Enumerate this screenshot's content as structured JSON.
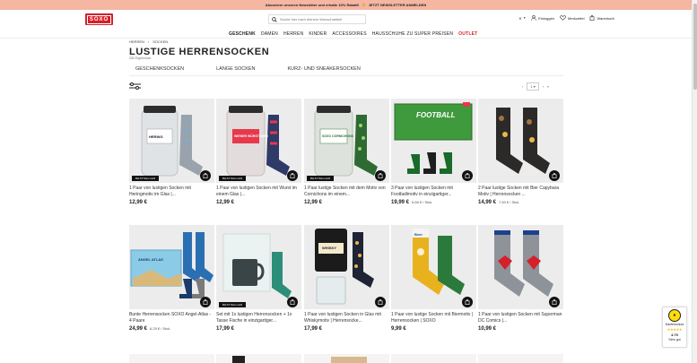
{
  "promo": {
    "text": "Abonniere unseren Newsletter und erhalte 10% Rabatt!",
    "cta": "JETZT NEWSLETTER ANMELDEN"
  },
  "brand": {
    "logo": "SOXO",
    "accent": "#d5202c"
  },
  "search": {
    "placeholder": "Suche hier nach deinem Wunschartikel"
  },
  "header": {
    "currency": "€",
    "login": "Einloggen",
    "wishlist": "Merkzettel",
    "cart": "Warenkorb"
  },
  "nav": {
    "items": [
      "GESCHENK",
      "DAMEN",
      "HERREN",
      "KINDER",
      "ACCESSOIRES",
      "HAUSSCHUHE ZU SUPER PREISEN",
      "OUTLET"
    ]
  },
  "breadcrumb": [
    "HERREN",
    "SOCKEN"
  ],
  "page": {
    "title": "LUSTIGE HERRENSOCKEN",
    "count": "280 Ergebnisse"
  },
  "subcategories": [
    "GESCHENKSOCKEN",
    "LANGE SOCKEN",
    "KURZ- UND SNEAKERSOCKEN"
  ],
  "pager": {
    "current": "1"
  },
  "products": [
    {
      "name": "1 Paar von lustigen Socken mit Heringmotiv im Glas |...",
      "price": "12,99 €",
      "unit": "",
      "badge": "BESTSELLER",
      "label": "HERING"
    },
    {
      "name": "1 Paar von lustigen Socken mit Wurst im einem Glas |...",
      "price": "12,99 €",
      "unit": "",
      "badge": "BESTSELLER",
      "label": "WIENER WÜRSTCHEN"
    },
    {
      "name": "1 Paar lustige Socken mit dem Motiv von Cornichons im einem...",
      "price": "12,99 €",
      "unit": "",
      "badge": "BESTSELLER",
      "label": "SOXO CORNICHONS"
    },
    {
      "name": "3 Paar von lustigen Socken mit Footballmotiv in einzigartiger...",
      "price": "19,99 €",
      "unit": "6,66 € / Stck.",
      "badge": "",
      "label": "FOOTBALL"
    },
    {
      "name": "2 Paar lustige Socken mit Bier Capybara Motiv | Herrensocken ...",
      "price": "14,99 €",
      "unit": "7,50 € / Stck.",
      "badge": "",
      "label": ""
    },
    {
      "name": "Bunte Herrensocken SOXO Angel-Atlas - 4 Paare",
      "price": "24,99 €",
      "unit": "6,25 € / Stck.",
      "badge": "",
      "label": "ANGEL ATLAS"
    },
    {
      "name": "Set mit 1x lustigen Herrensocken + 1x Tasse Fische in einzigartiger...",
      "price": "17,99 €",
      "unit": "",
      "badge": "BESTSELLER",
      "label": ""
    },
    {
      "name": "1 Paar von lustigen Socken in Glas mit Whiskymotiv | Herrensocke...",
      "price": "17,99 €",
      "unit": "",
      "badge": "",
      "label": "WHISKY"
    },
    {
      "name": "1 Paar von lustige Socken mit Biermotiv | Herrensocken | SOXO",
      "price": "9,99 €",
      "unit": "",
      "badge": "",
      "label": "Beer"
    },
    {
      "name": "1 Paar von lustigen Socken mit Superman DC Comics |...",
      "price": "10,99 €",
      "unit": "",
      "badge": "",
      "label": ""
    }
  ],
  "trust": {
    "title": "Käuferschutz",
    "rating": "4.79",
    "verdict": "Sehr gut"
  }
}
